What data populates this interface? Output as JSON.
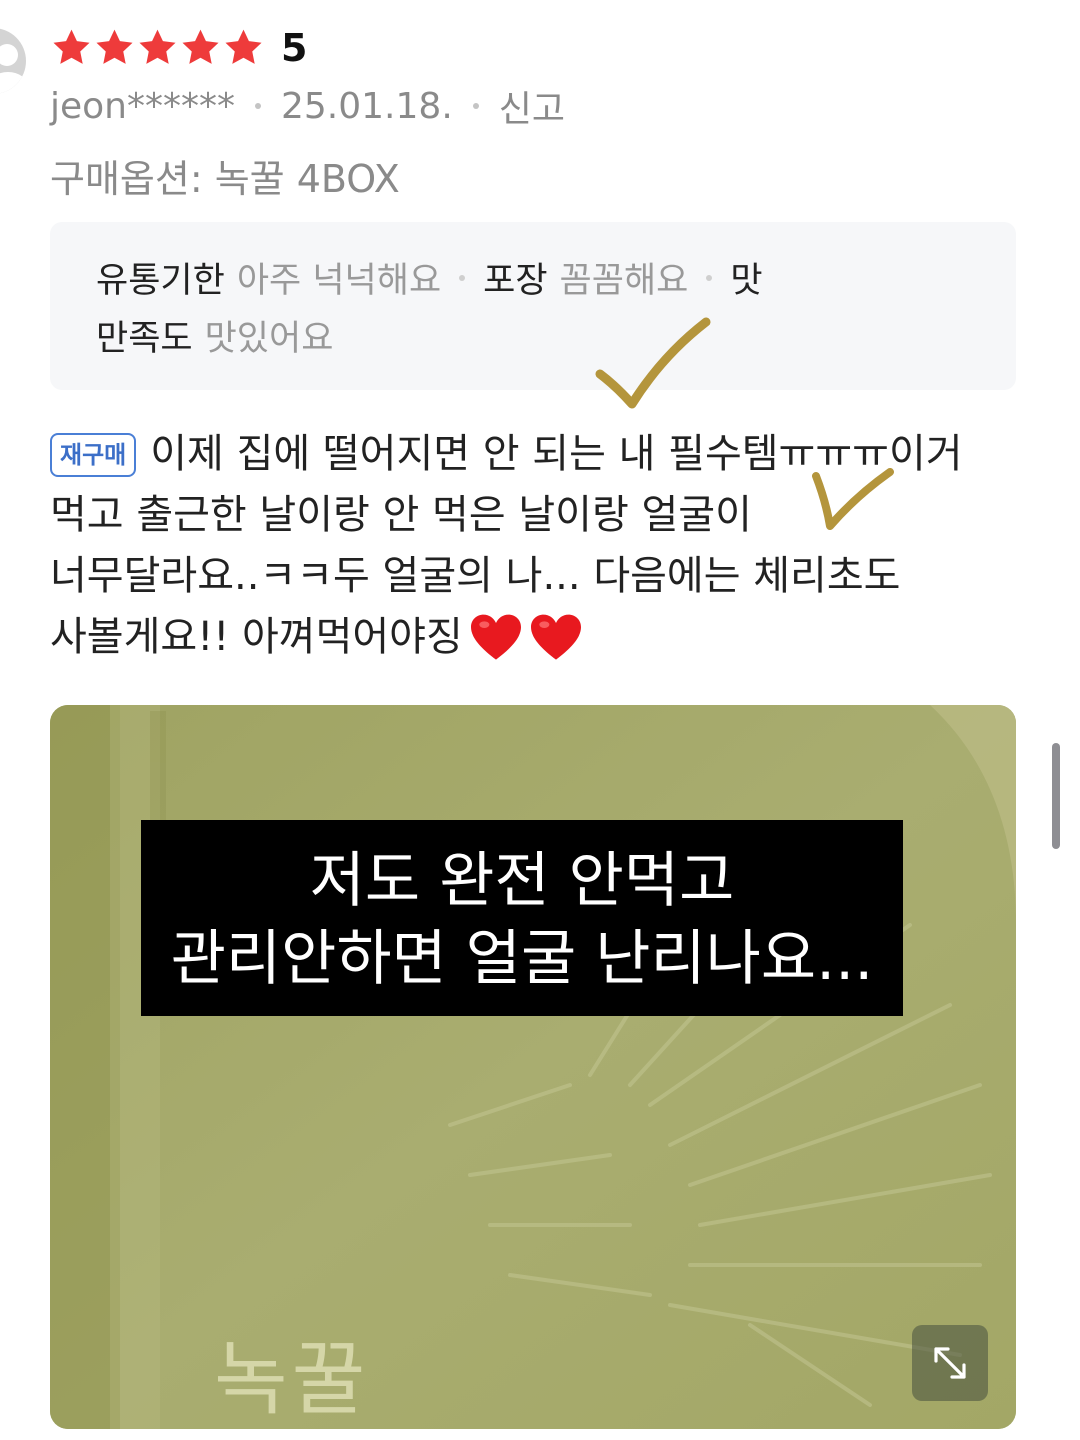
{
  "review": {
    "rating": "5",
    "rating_value": 5,
    "max_stars": 5,
    "user": "jeon******",
    "date": "25.01.18.",
    "report_label": "신고",
    "purchase_option": "구매옵션: 녹꿀 4BOX"
  },
  "summary": {
    "items": [
      {
        "key": "유통기한",
        "value": "아주 넉넉해요"
      },
      {
        "key": "포장",
        "value": "꼼꼼해요"
      },
      {
        "key": "맛",
        "value": ""
      },
      {
        "key": "만족도",
        "value": "맛있어요"
      }
    ]
  },
  "badge": {
    "label": "재구매"
  },
  "body": {
    "lines": [
      "이제 집에 떨어지면 안 되는 내 필수템ㅠㅠㅠ이거",
      "먹고 출근한 날이랑 안 먹은 날이랑 얼굴이",
      "너무달라요..ㅋㅋ두 얼굴의 나... 다음에는 체리초도",
      "사볼게요!! 아껴먹어야징"
    ]
  },
  "photo": {
    "caption_line1": "저도 완전 안먹고",
    "caption_line2": "관리안하면 얼굴 난리나요...",
    "box_text": "녹꿀",
    "expand_icon": "expand-icon"
  },
  "colors": {
    "star": "#ee3b3b",
    "heart": "#e8191f",
    "checkmark": "#b4953c",
    "photo_bg": "#a7ab6e",
    "badge": "#3c6fc8"
  }
}
